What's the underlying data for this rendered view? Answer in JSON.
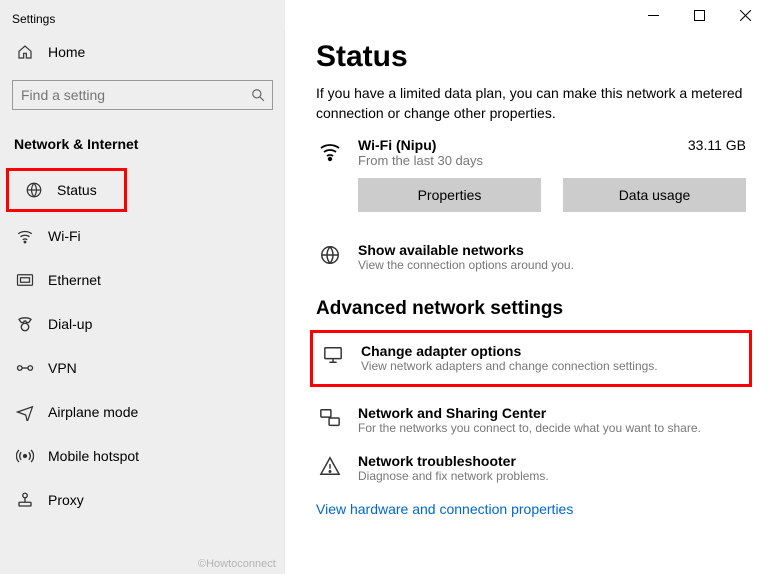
{
  "app_title": "Settings",
  "home_label": "Home",
  "search": {
    "placeholder": "Find a setting"
  },
  "category": "Network & Internet",
  "nav": {
    "status": "Status",
    "wifi": "Wi-Fi",
    "ethernet": "Ethernet",
    "dialup": "Dial-up",
    "vpn": "VPN",
    "airplane": "Airplane mode",
    "hotspot": "Mobile hotspot",
    "proxy": "Proxy"
  },
  "credit": "©Howtoconnect",
  "page": {
    "title": "Status",
    "subtitle": "If you have a limited data plan, you can make this network a metered connection or change other properties.",
    "conn_name": "Wi-Fi (Nipu)",
    "conn_sub": "From the last 30 days",
    "conn_size": "33.11 GB",
    "btn_properties": "Properties",
    "btn_datausage": "Data usage",
    "available": {
      "title": "Show available networks",
      "sub": "View the connection options around you."
    },
    "heading2": "Advanced network settings",
    "adapter": {
      "title": "Change adapter options",
      "sub": "View network adapters and change connection settings."
    },
    "sharing": {
      "title": "Network and Sharing Center",
      "sub": "For the networks you connect to, decide what you want to share."
    },
    "trouble": {
      "title": "Network troubleshooter",
      "sub": "Diagnose and fix network problems."
    },
    "link": "View hardware and connection properties"
  }
}
